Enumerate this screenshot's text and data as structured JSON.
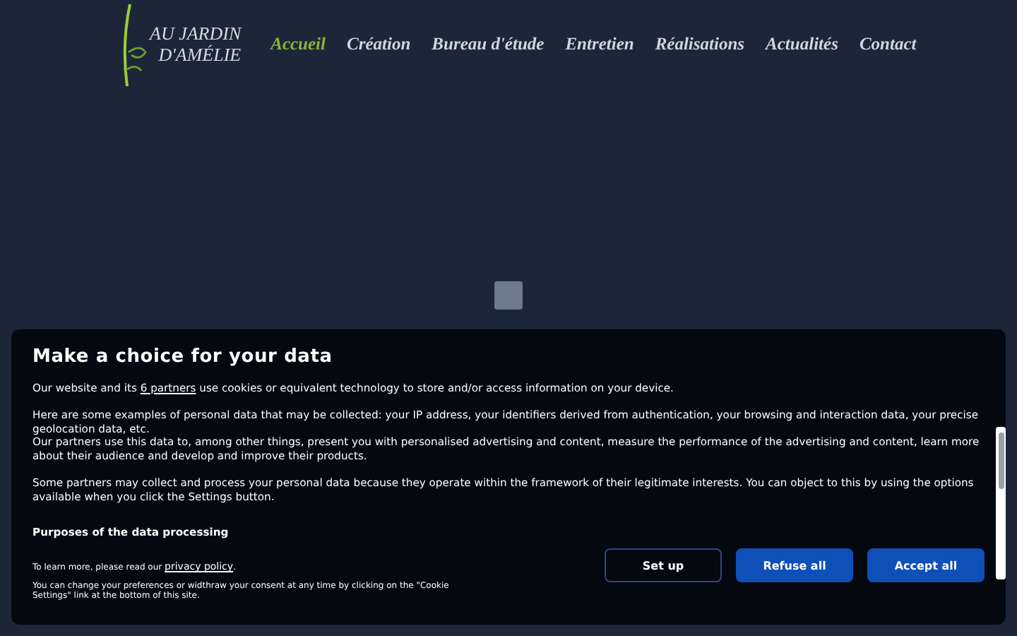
{
  "header": {
    "logo": [
      "AU JARDIN",
      "D'AMÉLIE"
    ],
    "nav": [
      {
        "label": "Accueil",
        "selected": true
      },
      {
        "label": "Création",
        "selected": false
      },
      {
        "label": "Bureau d'étude",
        "selected": false
      },
      {
        "label": "Entretien",
        "selected": false
      },
      {
        "label": "Réalisations",
        "selected": false
      },
      {
        "label": "Actualités",
        "selected": false
      },
      {
        "label": "Contact",
        "selected": false
      }
    ]
  },
  "consent": {
    "title": "Make a choice for your data",
    "blocks": [
      {
        "paragraphs": [
          {
            "parts": [
              {
                "text": "Our website and its "
              },
              {
                "text": "6 partners",
                "link": true
              },
              {
                "text": " use cookies or equivalent technology to store and/or access information on your device."
              }
            ]
          }
        ]
      },
      {
        "paragraphs": [
          {
            "parts": [
              {
                "text": "Here are some examples of personal data that may be collected: your IP address, your identifiers derived from authentication, your browsing and interaction data, your precise geolocation data, etc."
              }
            ]
          },
          {
            "parts": [
              {
                "text": "Our partners use this data to, among other things, present you with personalised advertising and content, measure the performance of the advertising and content, learn more about their audience and develop and improve their products."
              }
            ]
          }
        ]
      },
      {
        "paragraphs": [
          {
            "parts": [
              {
                "text": "Some partners may collect and process your personal data because they operate within the framework of their legitimate interests. You can object to this by using the options available when you click the Settings button."
              }
            ]
          }
        ]
      }
    ],
    "purposes": "Purposes of the data processing",
    "notes": [
      {
        "parts": [
          {
            "text": "To learn more, please read our "
          },
          {
            "text": "privacy policy",
            "link": true
          },
          {
            "text": "."
          }
        ]
      },
      {
        "parts": [
          {
            "text": "You can change your preferences or widthraw your consent at any time by clicking on the \"Cookie Settings\" link at the bottom of this site."
          }
        ]
      }
    ],
    "buttons": [
      {
        "label": "Set up",
        "kind": "outline"
      },
      {
        "label": "Refuse all",
        "kind": "filled"
      },
      {
        "label": "Accept all",
        "kind": "filled"
      }
    ]
  }
}
